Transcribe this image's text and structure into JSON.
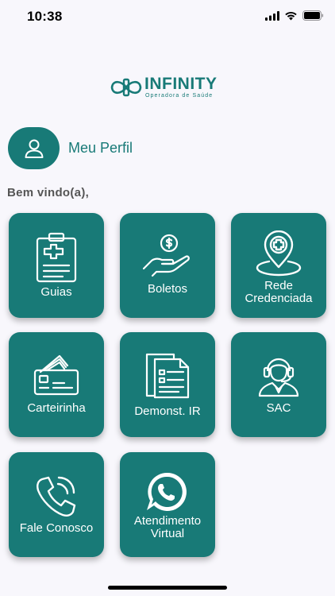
{
  "status_bar": {
    "time": "10:38"
  },
  "logo": {
    "name": "INFINITY",
    "subtitle": "Operadora de Saúde"
  },
  "profile": {
    "label": "Meu Perfil"
  },
  "welcome": "Bem vindo(a),",
  "tiles": [
    {
      "label": "Guias",
      "icon": "clipboard-medical-icon"
    },
    {
      "label": "Boletos",
      "icon": "hand-coin-icon"
    },
    {
      "label": "Rede Credenciada",
      "line1": "Rede",
      "line2": "Credenciada",
      "icon": "medical-location-pin-icon"
    },
    {
      "label": "Carteirinha",
      "icon": "id-cards-icon"
    },
    {
      "label": "Demonst. IR",
      "icon": "documents-icon"
    },
    {
      "label": "SAC",
      "icon": "headset-agent-icon"
    },
    {
      "label": "Fale Conosco",
      "icon": "phone-ringing-icon"
    },
    {
      "label": "Atendimento Virtual",
      "line1": "Atendimento",
      "line2": "Virtual",
      "icon": "whatsapp-icon"
    }
  ],
  "colors": {
    "primary": "#187a77",
    "background": "#f8f7fc",
    "welcome_text": "#555555"
  }
}
